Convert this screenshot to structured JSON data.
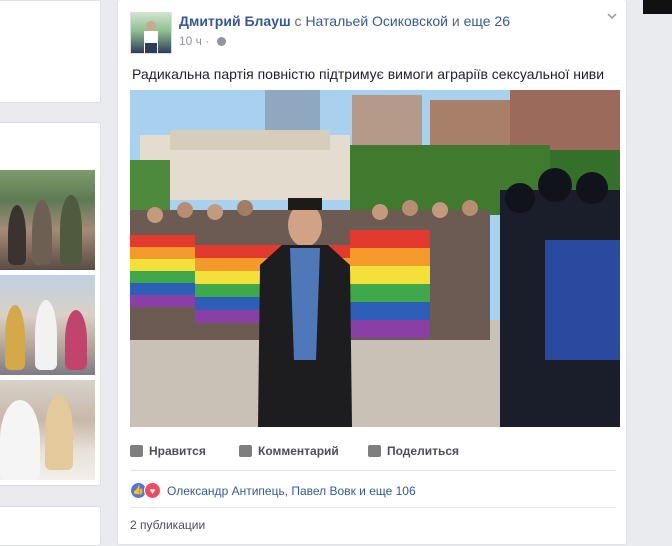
{
  "post": {
    "author": "Дмитрий Блауш",
    "connector": "с",
    "tagged": "Натальей Осиковской",
    "connector2": "и",
    "others": "еще 26",
    "time": "10 ч",
    "text": "Радикальна партія повністю підтримує вимоги аграріїв сексуальної ниви",
    "actions": {
      "like": "Нравится",
      "comment": "Комментарий",
      "share": "Поделиться"
    },
    "reactions_text": "Олександр Антипець, Павел Вовк и еще 106",
    "shares_text": "2 публикации"
  },
  "colors": {
    "link": "#365899",
    "like": "#4a76e6",
    "love": "#f04e60"
  },
  "icons": [
    "globe-icon",
    "chevron-down-icon",
    "like-icon",
    "comment-icon",
    "share-icon"
  ]
}
